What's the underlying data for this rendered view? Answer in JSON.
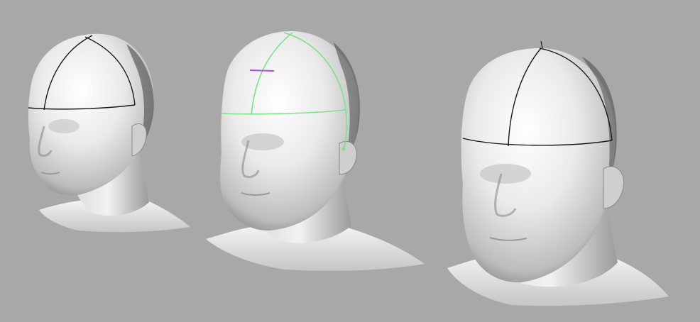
{
  "scene": {
    "background_color": "#a8a8a8",
    "head_count": 3,
    "heads": [
      {
        "id": "head-1",
        "curve_color": "#1a1a1a",
        "selected": false
      },
      {
        "id": "head-2",
        "curve_color": "#7fe08a",
        "selected": true,
        "marker_color": "#a64ddc"
      },
      {
        "id": "head-3",
        "curve_color": "#1a1a1a",
        "selected": false
      }
    ]
  }
}
